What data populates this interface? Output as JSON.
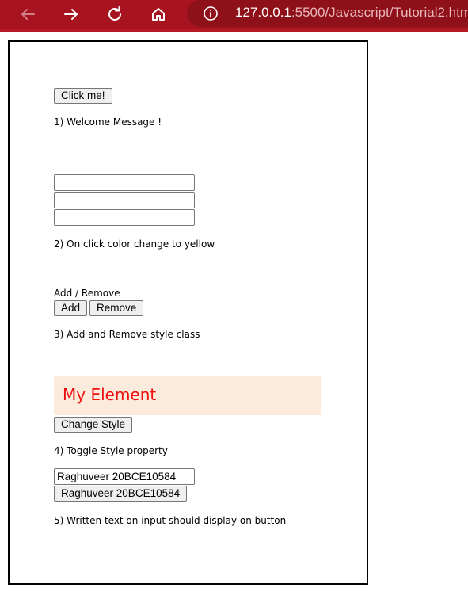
{
  "browser": {
    "url_host": "127.0.0.1",
    "url_path": ":5500/Javascript/Tutorial2.htm"
  },
  "section1": {
    "button_label": "Click me!",
    "caption": "1) Welcome Message !"
  },
  "section2": {
    "inputs": [
      "",
      "",
      ""
    ],
    "caption": "2) On click color change to yellow"
  },
  "section3": {
    "heading": "Add / Remove",
    "add_label": "Add",
    "remove_label": "Remove",
    "caption": "3) Add and Remove style class"
  },
  "section4": {
    "element_text": "My Element",
    "element_color": "#ee1111",
    "element_bg": "#faebdc",
    "button_label": "Change Style",
    "caption": "4) Toggle Style property"
  },
  "section5": {
    "input_value": "Raghuveer 20BCE10584",
    "button_label": "Raghuveer 20BCE10584",
    "caption": "5) Written text on input should display on button"
  },
  "colors": {
    "browser_bar": "#a7141f",
    "address_bar": "#8e1019"
  }
}
